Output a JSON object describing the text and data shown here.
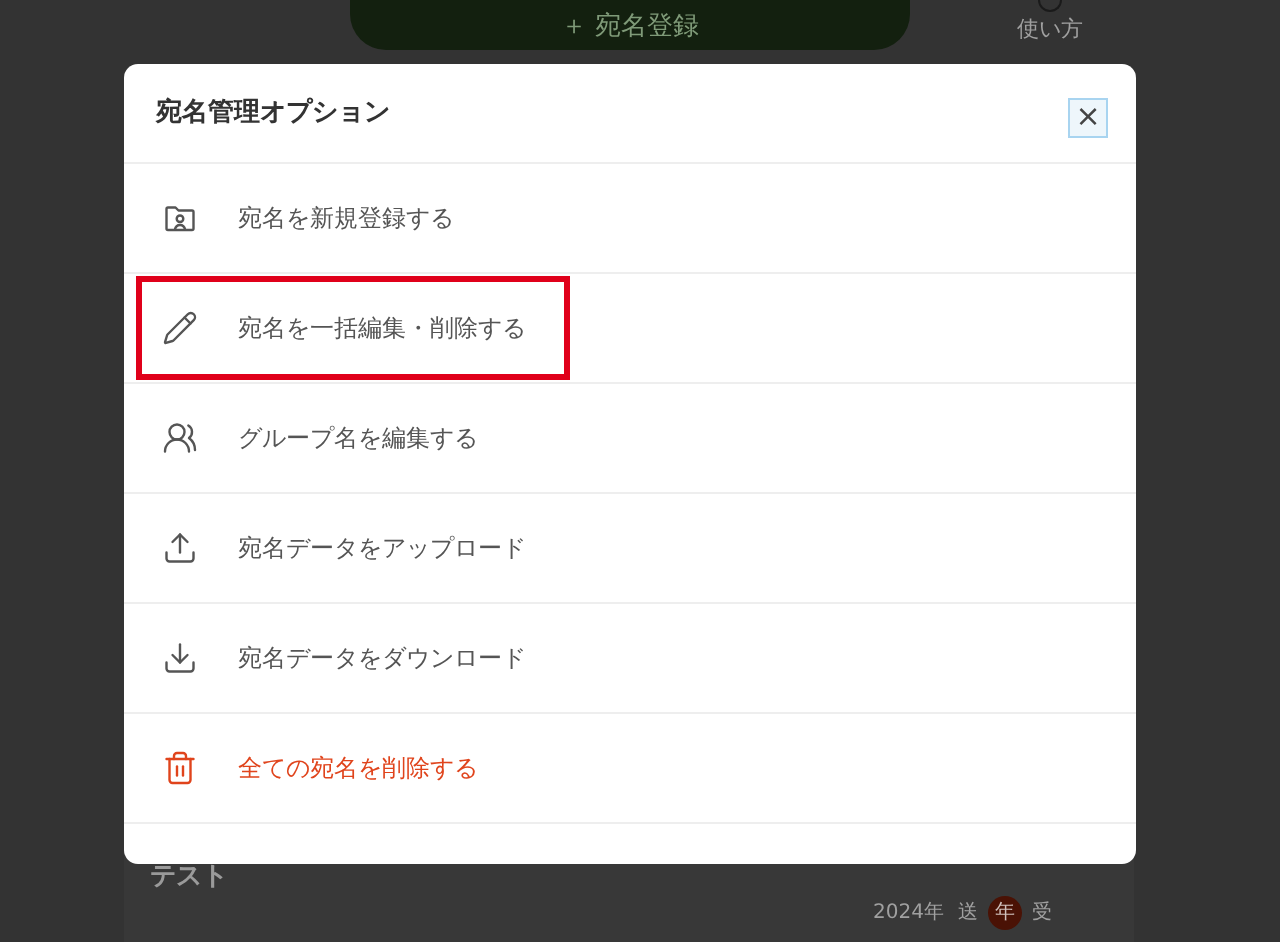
{
  "background": {
    "register_button": "＋ 宛名登録",
    "help_link": "使い方",
    "entry": {
      "name": "テスト",
      "year": "2024年",
      "sent": "送",
      "badge": "年",
      "received": "受"
    }
  },
  "modal": {
    "title": "宛名管理オプション",
    "close": "×",
    "items": [
      {
        "label": "宛名を新規登録する",
        "kind": "normal",
        "highlighted": false
      },
      {
        "label": "宛名を一括編集・削除する",
        "kind": "normal",
        "highlighted": true
      },
      {
        "label": "グループ名を編集する",
        "kind": "normal",
        "highlighted": false
      },
      {
        "label": "宛名データをアップロード",
        "kind": "normal",
        "highlighted": false
      },
      {
        "label": "宛名データをダウンロード",
        "kind": "normal",
        "highlighted": false
      },
      {
        "label": "全ての宛名を削除する",
        "kind": "danger",
        "highlighted": false
      }
    ]
  }
}
